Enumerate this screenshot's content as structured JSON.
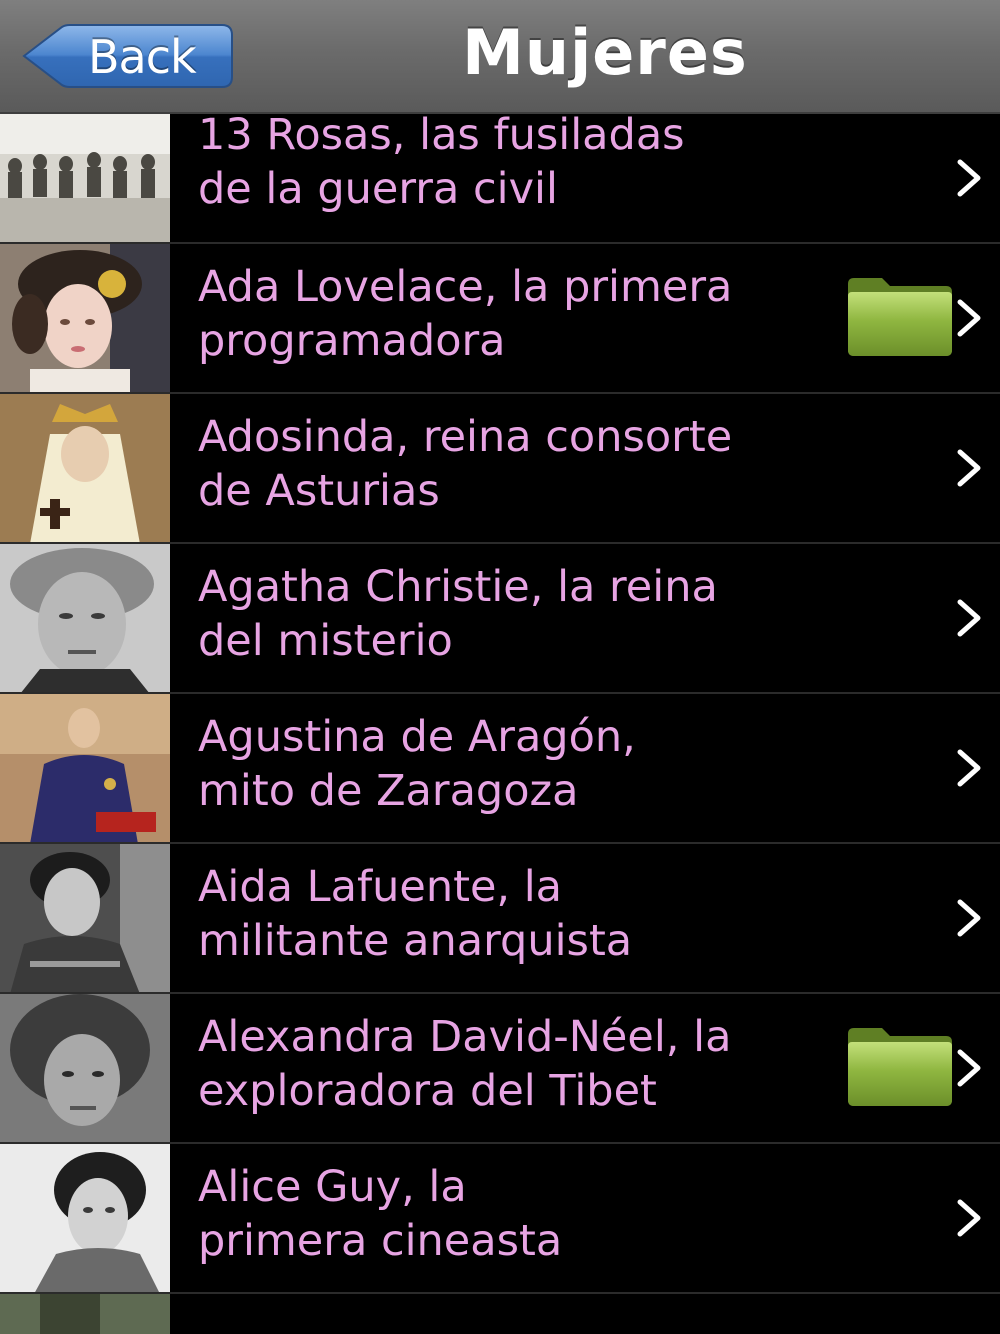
{
  "navbar": {
    "back_label": "Back",
    "title": "Mujeres"
  },
  "colors": {
    "accent_text": "#e7a4e3",
    "navbar": "#6b6b6b",
    "back_button": "#3f78c2",
    "folder": "#7da33a"
  },
  "list": {
    "items": [
      {
        "line1": "13 Rosas, las fusiladas",
        "line2": "de la guerra civil",
        "folder": false
      },
      {
        "line1": "Ada Lovelace, la primera",
        "line2": "programadora",
        "folder": true
      },
      {
        "line1": "Adosinda, reina consorte",
        "line2": "de Asturias",
        "folder": false
      },
      {
        "line1": "Agatha Christie, la reina",
        "line2": "del misterio",
        "folder": false
      },
      {
        "line1": "Agustina de Aragón,",
        "line2": "mito de Zaragoza",
        "folder": false
      },
      {
        "line1": "Aida Lafuente, la",
        "line2": "militante anarquista",
        "folder": false
      },
      {
        "line1": "Alexandra David-Néel, la",
        "line2": "exploradora del Tibet",
        "folder": true
      },
      {
        "line1": "Alice Guy, la",
        "line2": "primera cineasta",
        "folder": false
      }
    ]
  }
}
